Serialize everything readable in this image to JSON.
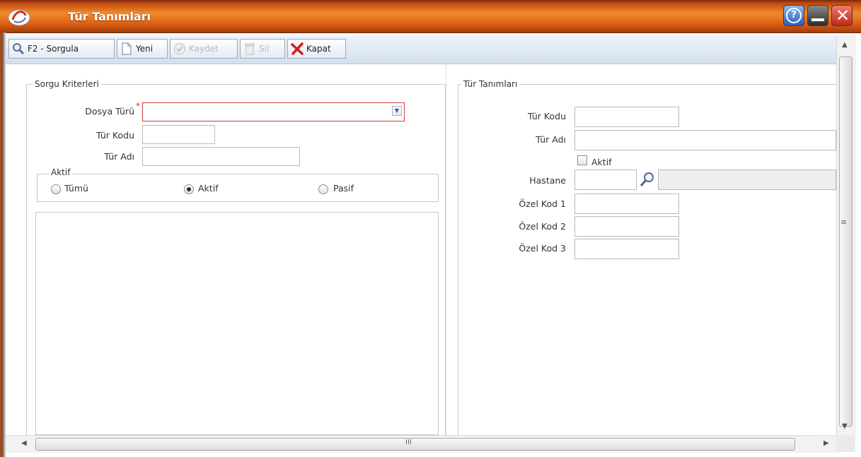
{
  "window": {
    "title": "Tür Tanımları"
  },
  "toolbar": {
    "query_label": "F2 - Sorgula",
    "new_label": "Yeni",
    "save_label": "Kaydet",
    "delete_label": "Sil",
    "close_label": "Kapat"
  },
  "criteria": {
    "legend": "Sorgu Kriterleri",
    "dosya_turu_label": "Dosya Türü",
    "required_mark": "*",
    "dosya_turu_value": "",
    "tur_kodu_label": "Tür Kodu",
    "tur_kodu_value": "",
    "tur_adi_label": "Tür Adı",
    "tur_adi_value": "",
    "aktif_group": {
      "legend": "Aktif",
      "options": [
        "Tümü",
        "Aktif",
        "Pasif"
      ],
      "selected": "Aktif"
    }
  },
  "details": {
    "legend": "Tür Tanımları",
    "tur_kodu_label": "Tür Kodu",
    "tur_kodu_value": "",
    "tur_adi_label": "Tür Adı",
    "tur_adi_value": "",
    "aktif_label": "Aktif",
    "aktif_checked": false,
    "hastane_label": "Hastane",
    "hastane_code": "",
    "hastane_name": "",
    "ozel_kod_1_label": "Özel Kod 1",
    "ozel_kod_2_label": "Özel Kod 2",
    "ozel_kod_3_label": "Özel Kod 3",
    "ozel_kod_1_value": "",
    "ozel_kod_2_value": "",
    "ozel_kod_3_value": ""
  },
  "scrollbar": {
    "v_grip": "≡",
    "h_grip": "III"
  },
  "colors": {
    "title_bar": "#e06414",
    "required_border": "#d23a3a",
    "toolbar_bg": "#dce6f2"
  }
}
